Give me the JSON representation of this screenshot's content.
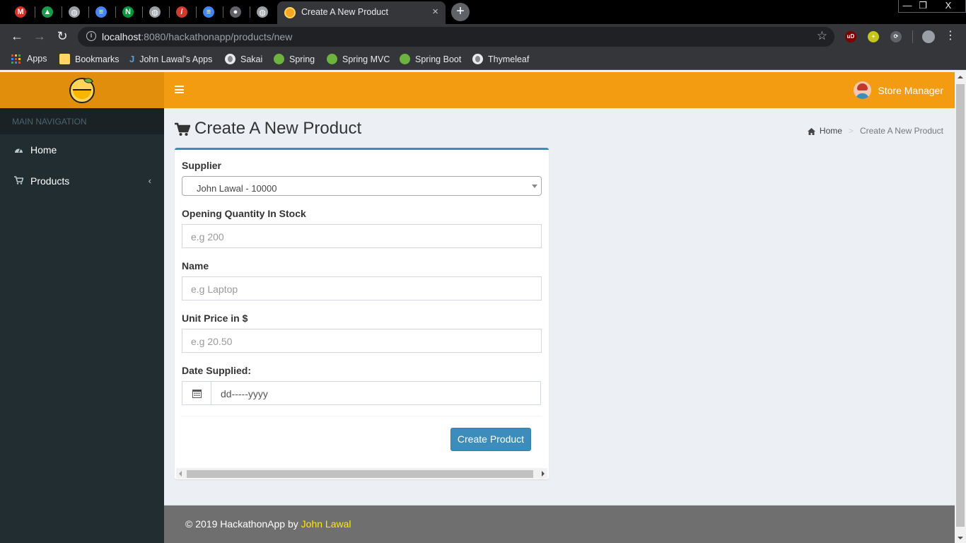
{
  "browser": {
    "active_tab_title": "Create A New Product",
    "tab_close": "×",
    "new_tab": "+",
    "url_host": "localhost",
    "url_rest": ":8080/hackathonapp/products/new",
    "window_controls": {
      "minimize": "—",
      "restore": "❐",
      "close": "X"
    },
    "extensions": [
      {
        "name": "ublock-icon",
        "text": "uD",
        "color": "#800000"
      },
      {
        "name": "extension-plus-icon",
        "text": "+",
        "color": "#c5c51c"
      },
      {
        "name": "sync-icon",
        "text": "⟳",
        "color": "#5f6368"
      }
    ],
    "pinned_tabs": [
      {
        "name": "gmail-tab-icon",
        "text": "M",
        "color": "#d93025"
      },
      {
        "name": "drive-tab-icon",
        "text": "▲",
        "color": "#1a9b4a"
      },
      {
        "name": "globe-tab-icon",
        "text": "◍",
        "color": "#9aa0a6"
      },
      {
        "name": "docs-tab-icon",
        "text": "≡",
        "color": "#4285f4"
      },
      {
        "name": "nginx-tab-icon",
        "text": "N",
        "color": "#009639"
      },
      {
        "name": "globe-tab-icon",
        "text": "◍",
        "color": "#9aa0a6"
      },
      {
        "name": "feather-tab-icon",
        "text": "/",
        "color": "#d33a2c"
      },
      {
        "name": "docs-tab-icon",
        "text": "≡",
        "color": "#4285f4"
      },
      {
        "name": "github-tab-icon",
        "text": "●",
        "color": "#5f6368"
      },
      {
        "name": "globe-tab-icon",
        "text": "◍",
        "color": "#9aa0a6"
      }
    ]
  },
  "bookmarks": [
    {
      "label": "Apps",
      "icon": "apps-grid-icon"
    },
    {
      "label": "Bookmarks",
      "icon": "folder-icon"
    },
    {
      "label": "John Lawal's Apps",
      "icon": "jl-icon"
    },
    {
      "label": "Sakai",
      "icon": "globe-icon"
    },
    {
      "label": "Spring",
      "icon": "spring-leaf-icon"
    },
    {
      "label": "Spring MVC",
      "icon": "spring-leaf-icon"
    },
    {
      "label": "Spring Boot",
      "icon": "spring-leaf-icon"
    },
    {
      "label": "Thymeleaf",
      "icon": "globe-icon"
    }
  ],
  "topnav": {
    "user_name": "Store Manager"
  },
  "sidebar": {
    "header": "MAIN NAVIGATION",
    "items": [
      {
        "label": "Home",
        "icon": "dashboard-icon"
      },
      {
        "label": "Products",
        "icon": "cart-icon"
      }
    ]
  },
  "page": {
    "title": "Create A New Product",
    "breadcrumb": {
      "home": "Home",
      "current": "Create A New Product"
    }
  },
  "form": {
    "supplier_label": "Supplier",
    "supplier_value": "John Lawal - 10000",
    "quantity_label": "Opening Quantity In Stock",
    "quantity_placeholder": "e.g 200",
    "name_label": "Name",
    "name_placeholder": "e.g Laptop",
    "price_label": "Unit Price in $",
    "price_placeholder": "e.g 20.50",
    "date_label": "Date Supplied:",
    "date_placeholder": "dd-----yyyy",
    "submit_label": "Create Product"
  },
  "footer": {
    "text": "© 2019 HackathonApp by ",
    "author": "John Lawal"
  },
  "colors": {
    "topnav": "#f39c12",
    "logo_bg": "#e08e0b",
    "sidebar": "#222d32",
    "primary": "#3c8dbc",
    "footer": "#6f6f6f",
    "author_link": "#ffea00"
  }
}
